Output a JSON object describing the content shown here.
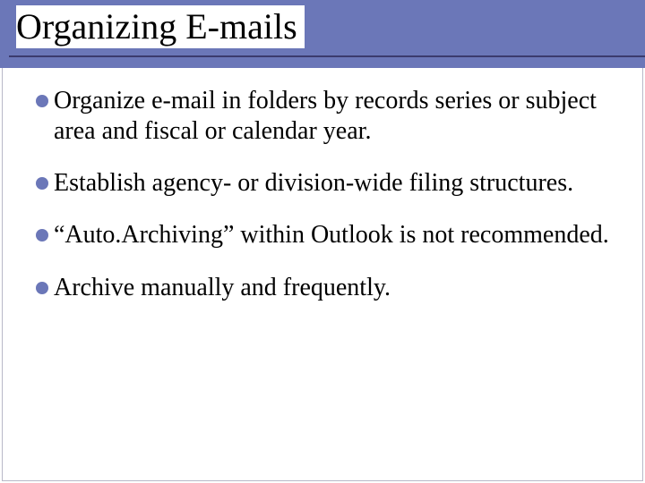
{
  "slide": {
    "title": "Organizing E-mails",
    "bullets": [
      "Organize e-mail in folders by records series or subject area and fiscal or calendar year.",
      "Establish agency- or division-wide filing structures.",
      "“Auto.Archiving” within Outlook is not recommended.",
      "Archive manually and frequently."
    ]
  },
  "colors": {
    "accent": "#6b77b8",
    "underline": "#3b3b6d"
  }
}
